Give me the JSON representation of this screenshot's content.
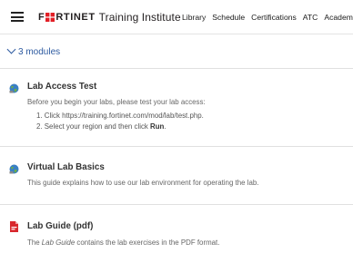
{
  "navbar": {
    "logo_word": "F RTINET",
    "logo_subtitle": "Training Institute",
    "links": [
      "Library",
      "Schedule",
      "Certifications",
      "ATC",
      "Academi"
    ]
  },
  "modules_toggle": {
    "label": "3 modules"
  },
  "modules": [
    {
      "title": "Lab Access Test",
      "description": "Before you begin your labs, please test your lab access:",
      "steps": [
        {
          "num": "1.",
          "text": "Click ",
          "link": "https://training.fortinet.com/mod/lab/test.php",
          "suffix": "."
        },
        {
          "num": "2.",
          "text": "Select your region and then click ",
          "bold": "Run",
          "suffix": "."
        }
      ],
      "icon": "lab-globe-icon"
    },
    {
      "title": "Virtual Lab Basics",
      "description": "This guide explains how to use our lab environment for operating the lab.",
      "icon": "lab-globe-icon"
    },
    {
      "title": "Lab Guide (pdf)",
      "description_prefix": "The ",
      "description_italic": "Lab Guide",
      "description_suffix": " contains the lab exercises in the PDF format.",
      "icon": "pdf-icon"
    }
  ],
  "colors": {
    "link": "#2d5aa0",
    "pdf_red": "#d8272d",
    "globe_blue": "#3a7fc4",
    "globe_green": "#6fb043"
  }
}
